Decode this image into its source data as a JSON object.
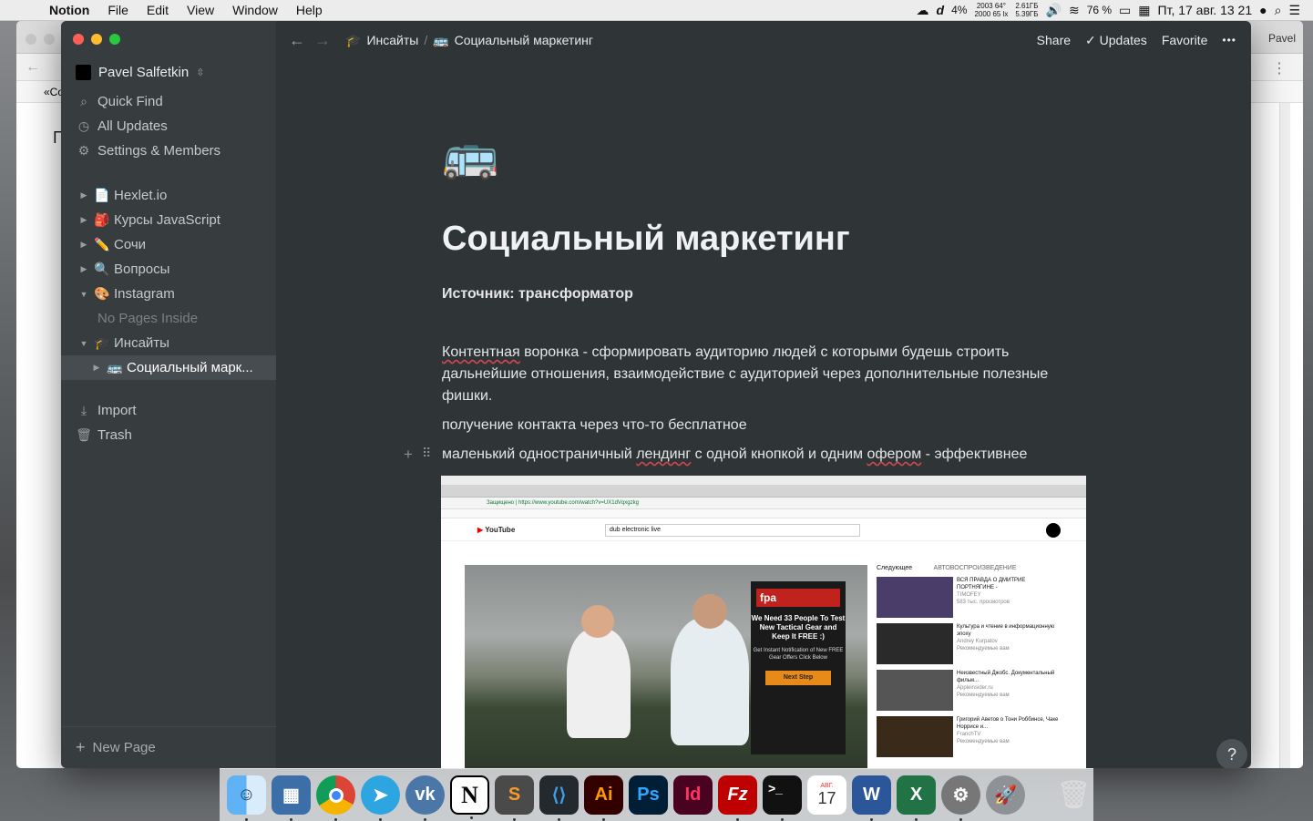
{
  "menubar": {
    "app_name": "Notion",
    "menus": [
      "File",
      "Edit",
      "View",
      "Window",
      "Help"
    ],
    "status": {
      "cpu": "4%",
      "sensor_top": "2003  64°",
      "sensor_bottom": "2000  65 lx",
      "mem_top": "2.61ГБ",
      "mem_bottom": "5.39ГБ",
      "battery": "76 %",
      "datetime": "Пт, 17 авг.  13 21"
    }
  },
  "chrome": {
    "profile": "Pavel",
    "tab_fragment": "«Со",
    "page_fragment": "П"
  },
  "sidebar": {
    "workspace": "Pavel Salfetkin",
    "top_items": [
      {
        "label": "Quick Find"
      },
      {
        "label": "All Updates"
      },
      {
        "label": "Settings & Members"
      }
    ],
    "pages": [
      {
        "label": "Hexlet.io",
        "emoji": "📄",
        "expanded": false
      },
      {
        "label": "Курсы JavaScript",
        "emoji": "🎒",
        "expanded": false
      },
      {
        "label": "Сочи",
        "emoji": "✏️",
        "expanded": false
      },
      {
        "label": "Вопросы",
        "emoji": "🔍",
        "expanded": false
      },
      {
        "label": "Instagram",
        "emoji": "🎨",
        "expanded": true
      }
    ],
    "no_pages_inside": "No Pages Inside",
    "insights": {
      "label": "Инсайты",
      "emoji": "🎓"
    },
    "active_page": {
      "label": "Социальный марк...",
      "emoji": "🚌"
    },
    "import": "Import",
    "trash": "Trash",
    "new_page": "New Page"
  },
  "topbar": {
    "breadcrumb_parent": "Инсайты",
    "breadcrumb_parent_emoji": "🎓",
    "breadcrumb_current": "Социальный маркетинг",
    "breadcrumb_current_emoji": "🚌",
    "share": "Share",
    "updates": "Updates",
    "favorite": "Favorite",
    "more": "•••"
  },
  "page": {
    "icon": "🚌",
    "title": "Социальный маркетинг",
    "source": "Источник: трансформатор",
    "p1_lead": "Контентная",
    "p1_rest": " воронка - сформировать аудиторию людей с которыми будешь строить дальнейшие отношения, взаимодействие с аудиторией через дополнительные полезные фишки.",
    "p2": "получение контакта через что-то бесплатное",
    "p3_a": "маленький одностраничный ",
    "p3_b": "лендинг",
    "p3_c": " с одной кнопкой и одним ",
    "p3_d": "офером",
    "p3_e": " - эффективнее",
    "help": "?"
  },
  "embedded_screenshot": {
    "url": "https://www.youtube.com/watch?v=UX1dVqxgzkg",
    "secure_label": "Защищено",
    "youtube_logo": "YouTube",
    "search_query": "dub electronic live",
    "next_label": "Следующее",
    "autoplay_label": "АВТОВОСПРОИЗВЕДЕНИЕ",
    "ad": {
      "brand": "fpa",
      "headline": "We Need 33 People To Test New Tactical Gear and Keep It FREE :)",
      "sub": "Get Instant Notification of New FREE Gear Offers Click Below",
      "button": "Next Step"
    },
    "videos": [
      {
        "title": "ВСЯ ПРАВДА О ДМИТРИЕ ПОРТНЯГИНЕ -",
        "channel": "TIMOFEY",
        "meta": "583 тыс. просмотров"
      },
      {
        "title": "Культура и чтение в информационную эпоху",
        "channel": "Andrey Kurpatov",
        "meta": "Рекомендуемые вам"
      },
      {
        "title": "Неизвестный Джобс. Документальный фильм...",
        "channel": "Appleinsider.ru",
        "meta": "Рекомендуемые вам"
      },
      {
        "title": "Григорий Аветов о Тони Роббинсе, Чаке Норрисе и...",
        "channel": "FranchTV",
        "meta": "Рекомендуемые вам"
      }
    ]
  },
  "dock": {
    "apps": [
      "Finder",
      "Launchpad",
      "Chrome",
      "Telegram",
      "VK",
      "Notion",
      "Sublime Text",
      "VS Code",
      "Illustrator",
      "Photoshop",
      "InDesign",
      "FileZilla",
      "Terminal",
      "Calendar",
      "Word",
      "Excel",
      "System Preferences",
      "Rocket",
      "Trash"
    ],
    "calendar_month": "АВГ.",
    "calendar_day": "17"
  },
  "colors": {
    "notion_bg": "#2f3437",
    "sidebar_bg": "#373c3f",
    "active_item": "#474c50",
    "traffic_red": "#ff5f57",
    "traffic_yellow": "#febc2e",
    "traffic_green": "#28c840"
  }
}
